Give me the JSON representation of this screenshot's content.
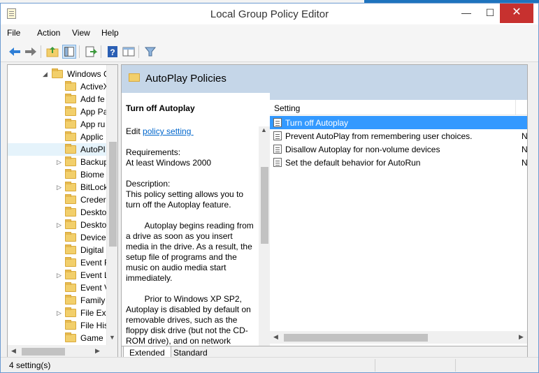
{
  "window": {
    "title": "Local Group Policy Editor",
    "controls": {
      "minimize": "—",
      "maximize": "☐",
      "close": "✕"
    }
  },
  "menu": [
    "File",
    "Action",
    "View",
    "Help"
  ],
  "toolbar": {
    "icons": [
      "back-icon",
      "forward-icon",
      "up-folder-icon",
      "show-hide-tree-icon",
      "export-list-icon",
      "help-icon",
      "extended-view-icon",
      "filter-icon"
    ]
  },
  "tree": {
    "items": [
      {
        "label": "Windows C",
        "expander": "◢",
        "level": 0
      },
      {
        "label": "ActiveX",
        "expander": "",
        "level": 1
      },
      {
        "label": "Add fe",
        "expander": "",
        "level": 1
      },
      {
        "label": "App Pa",
        "expander": "",
        "level": 1
      },
      {
        "label": "App ru",
        "expander": "",
        "level": 1
      },
      {
        "label": "Applic",
        "expander": "",
        "level": 1
      },
      {
        "label": "AutoPl",
        "expander": "",
        "level": 1,
        "selected": true
      },
      {
        "label": "Backup",
        "expander": "▷",
        "level": 1
      },
      {
        "label": "Biome",
        "expander": "",
        "level": 1
      },
      {
        "label": "BitLock",
        "expander": "▷",
        "level": 1
      },
      {
        "label": "Creder",
        "expander": "",
        "level": 1
      },
      {
        "label": "Deskto",
        "expander": "",
        "level": 1
      },
      {
        "label": "Deskto",
        "expander": "▷",
        "level": 1
      },
      {
        "label": "Device",
        "expander": "",
        "level": 1
      },
      {
        "label": "Digital",
        "expander": "",
        "level": 1
      },
      {
        "label": "Event F",
        "expander": "",
        "level": 1
      },
      {
        "label": "Event L",
        "expander": "▷",
        "level": 1
      },
      {
        "label": "Event V",
        "expander": "",
        "level": 1
      },
      {
        "label": "Family",
        "expander": "",
        "level": 1
      },
      {
        "label": "File Exp",
        "expander": "▷",
        "level": 1
      },
      {
        "label": "File His",
        "expander": "",
        "level": 1
      },
      {
        "label": "Game",
        "expander": "",
        "level": 1
      }
    ]
  },
  "right": {
    "header_title": "AutoPlay Policies",
    "description": {
      "title": "Turn off Autoplay",
      "edit_prefix": "Edit ",
      "edit_link": "policy setting ",
      "requirements_label": "Requirements:",
      "requirements_value": "At least Windows 2000",
      "description_label": "Description:",
      "para1": "This policy setting allows you to turn off the Autoplay feature.",
      "para2": "        Autoplay begins reading from a drive as soon as you insert media in the drive. As a result, the setup file of programs and the music on audio media start immediately.",
      "para3": "        Prior to Windows XP SP2, Autoplay is disabled by default on removable drives, such as the floppy disk drive (but not the CD-ROM drive), and on network"
    },
    "list": {
      "column": "Setting",
      "rows": [
        {
          "name": "Turn off Autoplay",
          "state": "",
          "selected": true
        },
        {
          "name": "Prevent AutoPlay from remembering user choices.",
          "state": "N"
        },
        {
          "name": "Disallow Autoplay for non-volume devices",
          "state": "N"
        },
        {
          "name": "Set the default behavior for AutoRun",
          "state": "N"
        }
      ]
    },
    "tabs": [
      "Extended",
      "Standard"
    ]
  },
  "status": {
    "text": "4 setting(s)"
  },
  "colors": {
    "accent": "#3399ff",
    "header": "#c5d6e8",
    "link": "#0066cc"
  }
}
